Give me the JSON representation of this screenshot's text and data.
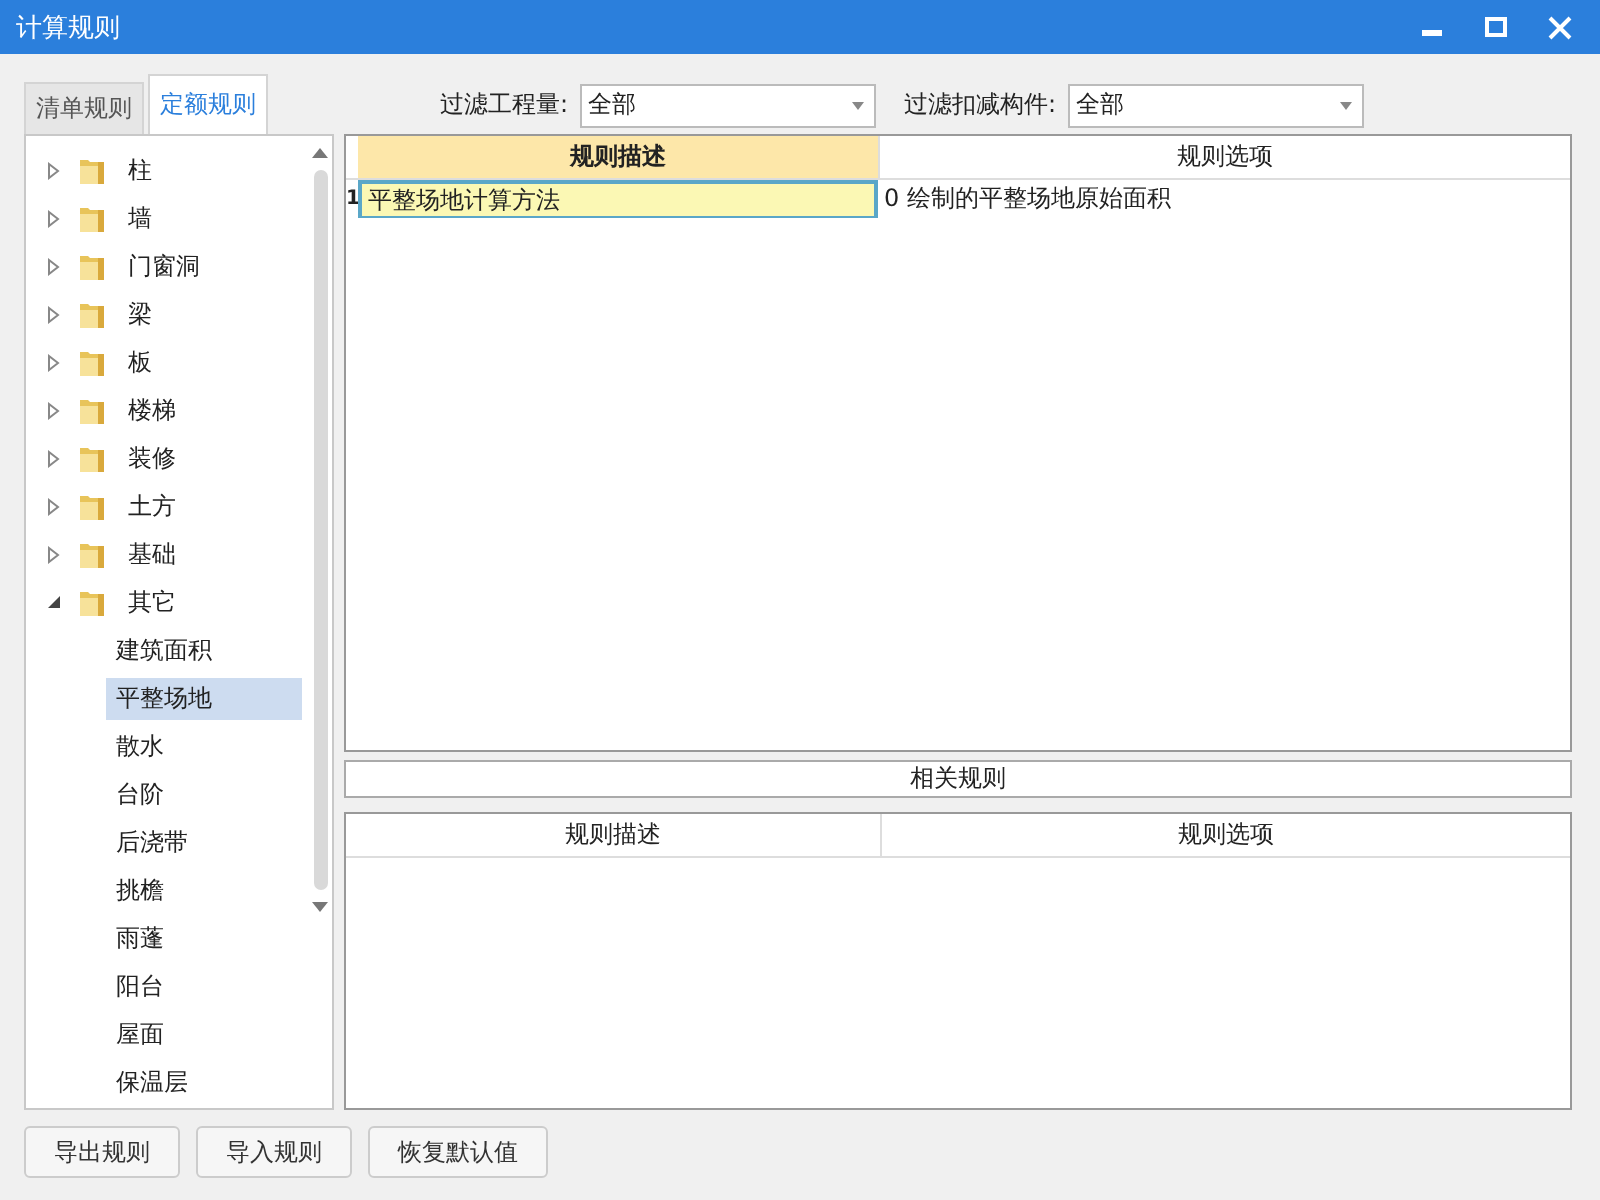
{
  "window": {
    "title": "计算规则"
  },
  "tabs": [
    {
      "label": "清单规则",
      "selected": false
    },
    {
      "label": "定额规则",
      "selected": true
    }
  ],
  "filters": [
    {
      "label": "过滤工程量:",
      "value": "全部"
    },
    {
      "label": "过滤扣减构件:",
      "value": "全部"
    }
  ],
  "tree": [
    {
      "label": "柱",
      "expanded": false,
      "selected": false
    },
    {
      "label": "墙",
      "expanded": false,
      "selected": false
    },
    {
      "label": "门窗洞",
      "expanded": false,
      "selected": false
    },
    {
      "label": "梁",
      "expanded": false,
      "selected": false
    },
    {
      "label": "板",
      "expanded": false,
      "selected": false
    },
    {
      "label": "楼梯",
      "expanded": false,
      "selected": false
    },
    {
      "label": "装修",
      "expanded": false,
      "selected": false
    },
    {
      "label": "土方",
      "expanded": false,
      "selected": false
    },
    {
      "label": "基础",
      "expanded": false,
      "selected": false
    },
    {
      "label": "其它",
      "expanded": true,
      "selected": false,
      "children": [
        {
          "label": "建筑面积",
          "selected": false
        },
        {
          "label": "平整场地",
          "selected": true
        },
        {
          "label": "散水",
          "selected": false
        },
        {
          "label": "台阶",
          "selected": false
        },
        {
          "label": "后浇带",
          "selected": false
        },
        {
          "label": "挑檐",
          "selected": false
        },
        {
          "label": "雨蓬",
          "selected": false
        },
        {
          "label": "阳台",
          "selected": false
        },
        {
          "label": "屋面",
          "selected": false
        },
        {
          "label": "保温层",
          "selected": false
        }
      ]
    }
  ],
  "rules_table": {
    "columns": [
      {
        "label": "规则描述",
        "selected": true
      },
      {
        "label": "规则选项",
        "selected": false
      }
    ],
    "rows": [
      {
        "index": "1",
        "description": "平整场地计算方法",
        "option": "0 绘制的平整场地原始面积",
        "selected": true
      }
    ]
  },
  "related_rules": {
    "title": "相关规则",
    "columns": [
      "规则描述",
      "规则选项"
    ]
  },
  "buttons": [
    "导出规则",
    "导入规则",
    "恢复默认值"
  ]
}
